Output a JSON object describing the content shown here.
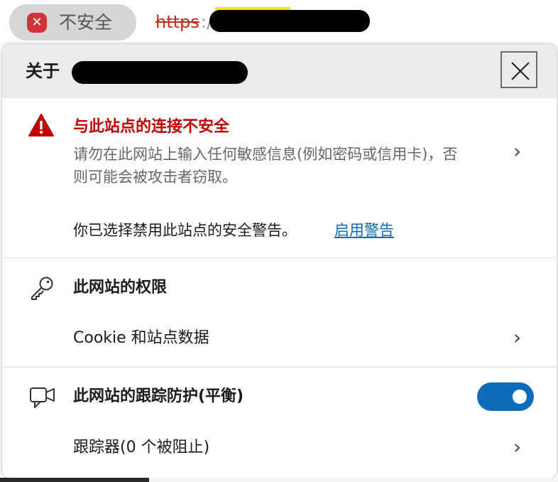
{
  "address_bar": {
    "security_label": "不安全",
    "url_scheme": "https",
    "url_separator": ":/"
  },
  "panel": {
    "header_title": "关于",
    "close_icon": "close-icon",
    "connection": {
      "icon": "warning-icon",
      "title": "与此站点的连接不安全",
      "description": "请勿在此网站上输入任何敏感信息(例如密码或信用卡)，否则可能会被攻击者窃取。",
      "disabled_warnings_note": "你已选择禁用此站点的安全警告。",
      "enable_warnings_link": "启用警告"
    },
    "permissions": {
      "icon": "key-icon",
      "title": "此网站的权限",
      "cookies_label": "Cookie 和站点数据"
    },
    "tracking": {
      "icon": "tracking-camera-icon",
      "title": "此网站的跟踪防护(平衡)",
      "toggle_on": true,
      "trackers_label": "跟踪器(0 个被阻止)"
    }
  },
  "colors": {
    "danger": "#c00000",
    "link": "#0f6cbd",
    "toggle": "#0f6cbd"
  }
}
